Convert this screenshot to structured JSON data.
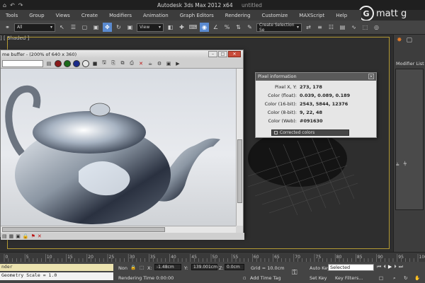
{
  "app": {
    "title": "Autodesk 3ds Max 2012 x64",
    "subtitle": "untitled",
    "watermark": "matt g",
    "watermark_logo": "G"
  },
  "quick_access": [
    "⌂",
    "↶",
    "↷"
  ],
  "menubar": [
    "Tools",
    "Group",
    "Views",
    "Create",
    "Modifiers",
    "Animation",
    "Graph Editors",
    "Rendering",
    "Customize",
    "MAXScript",
    "Help"
  ],
  "toolbar": {
    "filter_value": "All",
    "coord_value": "View",
    "selection_set_placeholder": "Create Selection Se",
    "icons": [
      "select-icon",
      "select-by-name-icon",
      "region-icon",
      "window-crossing-icon",
      "move-icon",
      "rotate-icon",
      "scale-icon"
    ]
  },
  "viewport": {
    "label": "] [ Shaded ]",
    "safe_frame_color": "#b49a34"
  },
  "right_panel": {
    "modifier_list_label": "Modifier List"
  },
  "frame_buffer": {
    "title": "me buffer - (200% of 640 x 360)"
  },
  "pixel_info": {
    "title": "Pixel information",
    "rows": [
      {
        "label": "Pixel X, Y:",
        "value": "273, 178"
      },
      {
        "label": "Color (float):",
        "value": "0.039, 0.089, 0.189"
      },
      {
        "label": "Color (16-bit):",
        "value": "2543, 5844, 12376"
      },
      {
        "label": "Color (8-bit):",
        "value": "9, 22, 48"
      },
      {
        "label": "Color (Web):",
        "value": "#091630"
      }
    ],
    "corrected_label": "Corrected colors",
    "sample_color": "#091630"
  },
  "timeline": {
    "ticks": [
      "0",
      "5",
      "10",
      "15",
      "20",
      "25",
      "30",
      "35",
      "40",
      "45",
      "50",
      "55",
      "60",
      "65",
      "70",
      "75",
      "80",
      "85",
      "90",
      "95",
      "100"
    ]
  },
  "status": {
    "maxscript_top": "nder",
    "maxscript_bottom": "Geometry Scale = 1.0",
    "selection": "Non",
    "x_label": "X:",
    "x_value": "-1.48cm",
    "y_label": "Y:",
    "y_value": "139.001cm",
    "z_label": "Z:",
    "z_value": "0.0cm",
    "grid": "Grid = 10.0cm",
    "rendering_time": "Rendering Time  0:00:00",
    "add_time_tag": "Add Time Tag",
    "auto_key": "Auto Key",
    "set_key": "Set Key",
    "selected": "Selected",
    "key_filters": "Key Filters..."
  }
}
